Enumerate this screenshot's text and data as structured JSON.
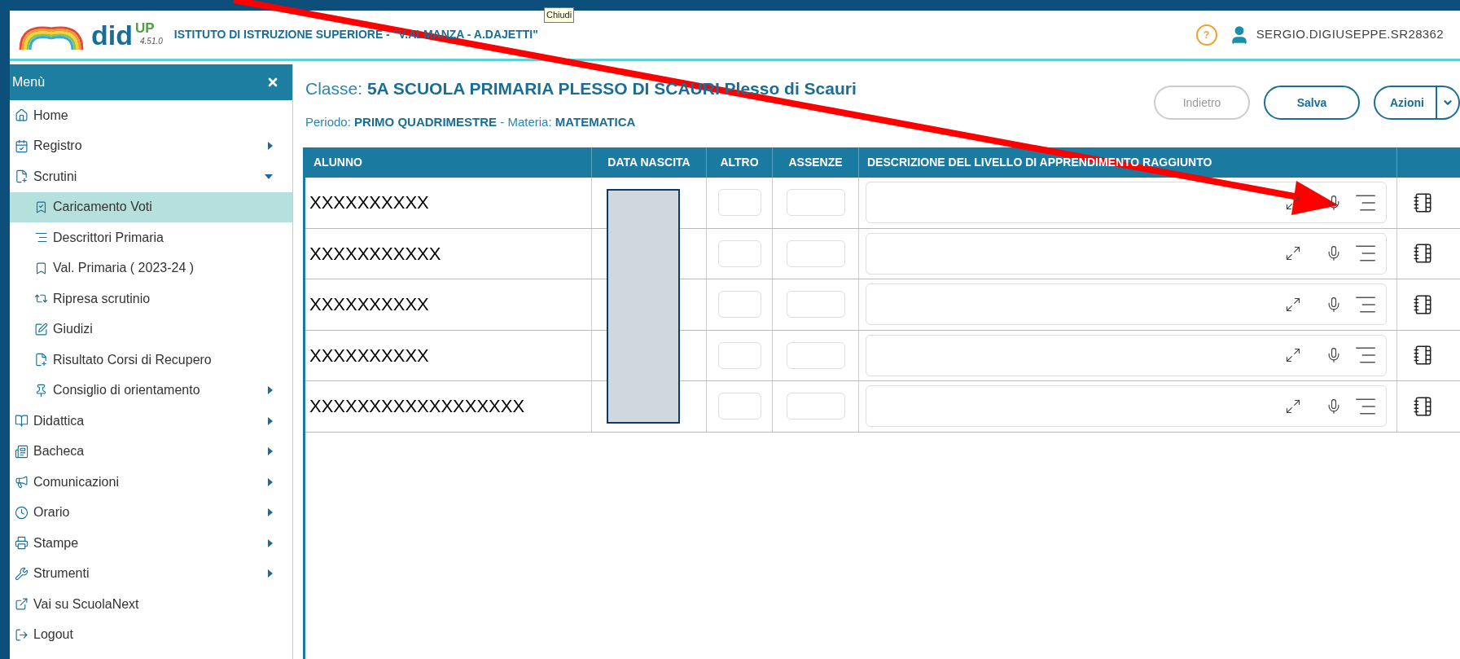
{
  "header": {
    "logo_text": "did",
    "logo_sup": "UP",
    "version": "4.51.0",
    "school": "ISTITUTO DI ISTRUZIONE SUPERIORE - \"V.ALMANZA - A.DAJETTI\"",
    "tooltip": "Chiudi",
    "help": "?",
    "user": "SERGIO.DIGIUSEPPE.SR28362"
  },
  "sidebar": {
    "title": "Menù",
    "items": [
      {
        "label": "Home",
        "selected": false
      },
      {
        "label": "Registro",
        "selected": false,
        "expanded": false
      },
      {
        "label": "Scrutini",
        "selected": false,
        "expanded": true,
        "children": [
          {
            "label": "Caricamento Voti",
            "selected": true
          },
          {
            "label": "Descrittori Primaria",
            "selected": false
          },
          {
            "label": "Val. Primaria ( 2023-24 )",
            "selected": false
          },
          {
            "label": "Ripresa scrutinio",
            "selected": false
          },
          {
            "label": "Giudizi",
            "selected": false
          },
          {
            "label": "Risultato Corsi di Recupero",
            "selected": false
          },
          {
            "label": "Consiglio di orientamento",
            "selected": false,
            "expanded": false
          }
        ]
      },
      {
        "label": "Didattica",
        "selected": false,
        "expanded": false
      },
      {
        "label": "Bacheca",
        "selected": false,
        "expanded": false
      },
      {
        "label": "Comunicazioni",
        "selected": false,
        "expanded": false
      },
      {
        "label": "Orario",
        "selected": false,
        "expanded": false
      },
      {
        "label": "Stampe",
        "selected": false,
        "expanded": false
      },
      {
        "label": "Strumenti",
        "selected": false,
        "expanded": false
      },
      {
        "label": "Vai su ScuolaNext",
        "selected": false
      },
      {
        "label": "Logout",
        "selected": false
      }
    ]
  },
  "content": {
    "class_label": "Classe:",
    "class_value": "5A SCUOLA PRIMARIA PLESSO DI SCAURI Plesso di Scauri",
    "period_label": "Periodo:",
    "period_value": "PRIMO QUADRIMESTRE",
    "separator": "-",
    "subject_label": "Materia:",
    "subject_value": "MATEMATICA",
    "buttons": [
      {
        "label": "Indietro",
        "disabled": true,
        "dropdown": false
      },
      {
        "label": "Salva",
        "disabled": false,
        "dropdown": false
      },
      {
        "label": "Azioni",
        "disabled": false,
        "dropdown": true
      }
    ],
    "table": {
      "columns": [
        "ALUNNO",
        "DATA NASCITA",
        "ALTRO",
        "ASSENZE",
        "DESCRIZIONE DEL LIVELLO DI APPRENDIMENTO RAGGIUNTO"
      ],
      "rows": [
        {
          "name": "XXXXXXXXXX"
        },
        {
          "name": "XXXXXXXXXXX"
        },
        {
          "name": "XXXXXXXXXX"
        },
        {
          "name": "XXXXXXXXXX"
        },
        {
          "name": "XXXXXXXXXXXXXXXXXX"
        }
      ]
    }
  }
}
